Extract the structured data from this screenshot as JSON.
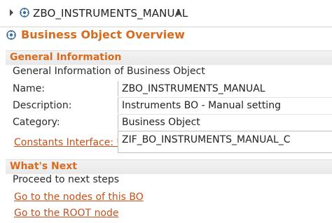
{
  "breadcrumb": {
    "label": "ZBO_INSTRUMENTS_MANUAL",
    "left_icon": "chevron-right-icon",
    "item_icon": "business-object-icon",
    "right_icon": "chevron-right-icon"
  },
  "overview": {
    "title": "Business Object Overview",
    "icon": "business-object-icon"
  },
  "general": {
    "section_title": "General Information",
    "description": "General Information of Business Object",
    "fields": [
      {
        "label": "Name:",
        "value": "ZBO_INSTRUMENTS_MANUAL"
      },
      {
        "label": "Description:",
        "value": "Instruments BO - Manual setting"
      },
      {
        "label": "Category:",
        "value": "Business Object"
      },
      {
        "label": "Constants Interface: *",
        "value": "ZIF_BO_INSTRUMENTS_MANUAL_C"
      }
    ]
  },
  "whats_next": {
    "section_title": "What's Next",
    "description": "Proceed to next steps",
    "links": [
      {
        "label": "Go to the nodes of this BO"
      },
      {
        "label": "Go to the ROOT node"
      }
    ]
  },
  "colors": {
    "accent": "#d86b1e",
    "link": "#c8501b"
  }
}
